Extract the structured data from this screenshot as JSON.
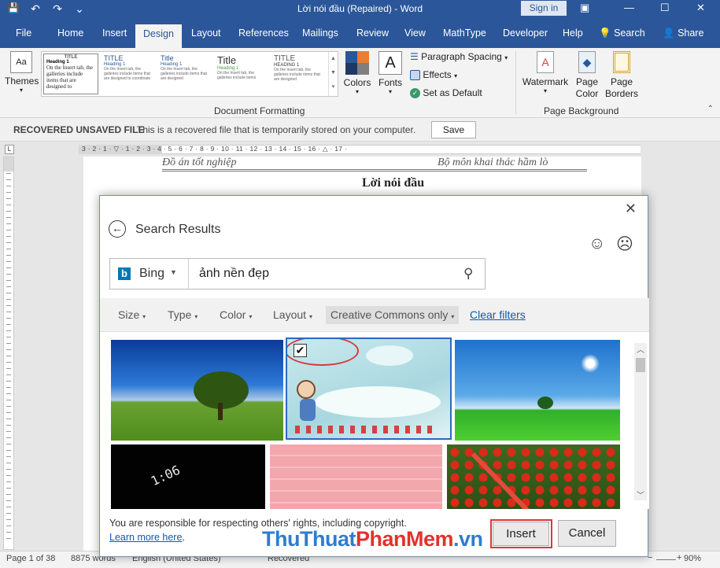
{
  "window": {
    "title": "Lời nói đầu (Repaired) - Word",
    "sign_in": "Sign in",
    "buttons": {
      "options": "▣",
      "minimize": "—",
      "maximize": "☐",
      "close": "✕"
    }
  },
  "qat": {
    "save": "💾",
    "undo": "↶",
    "redo": "↷",
    "more": "⌄"
  },
  "tabs": [
    "File",
    "Home",
    "Insert",
    "Design",
    "Layout",
    "References",
    "Mailings",
    "Review",
    "View",
    "MathType",
    "Developer",
    "Help"
  ],
  "tab_search": "Search",
  "tab_share": "Share",
  "active_tab": "Design",
  "ribbon": {
    "themes_label": "Themes",
    "styles": [
      {
        "title": "TITLE",
        "heading": "Heading 1",
        "body": "On the Insert tab, the galleries include items that are designed to"
      },
      {
        "title": "TITLE",
        "heading": "Heading 1",
        "body": "On the Insert tab, the galleries include items that are designed to coordinate"
      },
      {
        "title": "Title",
        "heading": "Heading 1",
        "body": "On the Insert tab, the galleries include items that are designed"
      },
      {
        "title": "Title",
        "heading": "Heading 1",
        "body": "On the Insert tab, the galleries include items"
      },
      {
        "title": "TITLE",
        "heading": "HEADING 1",
        "body": "On the Insert tab, the galleries include items that are designed"
      }
    ],
    "colors_label": "Colors",
    "fonts_label": "Fonts",
    "paragraph_spacing": "Paragraph Spacing",
    "effects": "Effects",
    "set_default": "Set as Default",
    "group_doc_formatting": "Document Formatting",
    "watermark": "Watermark",
    "page_color": "Page Color",
    "page_borders": "Page Borders",
    "group_page_background": "Page Background"
  },
  "recovered": {
    "title": "RECOVERED UNSAVED FILE",
    "message": "This is a recovered file that is temporarily stored on your computer.",
    "save": "Save"
  },
  "ruler_marks": "3 · 2 · 1 · ▽ · 1 · 2 · 3 · 4 · 5 · 6 · 7 · 8 · 9 · 10 · 11 · 12 · 13 · 14 · 15 · 16 · △ · 17 ·",
  "document": {
    "header_left": "Đồ án tốt nghiệp",
    "header_right": "Bộ môn khai thác hầm lò",
    "heading": "Lời nói đầu"
  },
  "dialog": {
    "title": "Search Results",
    "provider": "Bing",
    "query": "ảnh nền đẹp",
    "filters": [
      "Size",
      "Type",
      "Color",
      "Layout"
    ],
    "cc_filter": "Creative Commons only",
    "clear_filters": "Clear filters",
    "notice": "You are responsible for respecting others' rights, including copyright.",
    "learn_more": "Learn more here",
    "insert": "Insert",
    "cancel": "Cancel",
    "clock_text": "1:06"
  },
  "status": {
    "page": "Page 1 of 38",
    "words": "8875 words",
    "language": "English (United States)",
    "recovered": "Recovered",
    "zoom": "90%"
  },
  "watermark": {
    "part1": "Thu",
    "part2": "Thuat",
    "part3": "Phan",
    "part4": "Mem",
    "part5": ".vn"
  },
  "colors": {
    "brand": "#2b579a",
    "highlight": "#d63a3a"
  }
}
